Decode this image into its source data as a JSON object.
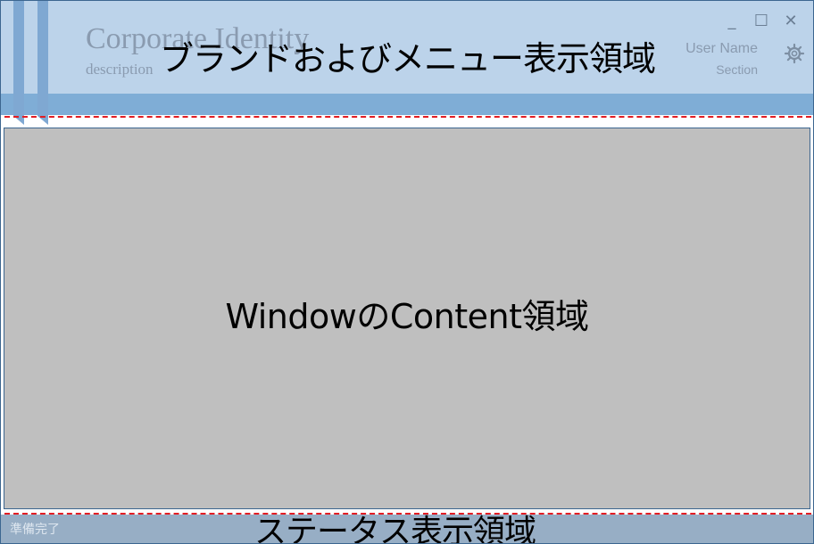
{
  "header": {
    "brand_title": "Corporate Identity",
    "brand_description": "description",
    "region_label": "ブランドおよびメニュー表示領域",
    "user": {
      "name": "User Name",
      "section": "Section"
    },
    "window_controls": {
      "minimize_glyph": "_",
      "maximize_glyph": "☐",
      "close_glyph": "✕"
    },
    "icons": [
      "minimize-icon",
      "maximize-icon",
      "close-icon",
      "gear-icon"
    ]
  },
  "content": {
    "region_label": "WindowのContent領域"
  },
  "status": {
    "text": "準備完了",
    "region_label": "ステータス表示領域"
  },
  "colors": {
    "header_bg": "#bcd3ea",
    "menu_bar_bg": "#7fadd6",
    "content_bg": "#bfbfbf",
    "status_bg": "#97aec5",
    "border": "#3c6690",
    "guide_dash": "#e21d24",
    "muted_text": "#8a9bb0"
  }
}
